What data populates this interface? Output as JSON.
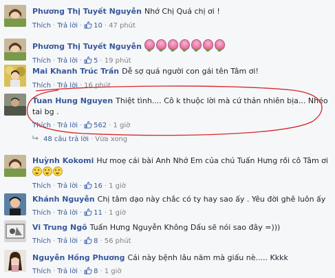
{
  "labels": {
    "like": "Thích",
    "reply": "Trả lời",
    "sep": "·"
  },
  "comments": [
    {
      "author": "Phương Thị Tuyết Nguyễn",
      "text": "Nhớ Chị Quá chị ơi !",
      "likes": "10",
      "time": "47 phút"
    },
    {
      "author": "Phương Thị Tuyết Nguyễn",
      "text": "",
      "likes": "5",
      "time": "19 phút",
      "emoji": [
        "pink-bud-emoji",
        "pink-bud-emoji",
        "pink-bud-emoji",
        "pink-bud-emoji",
        "pink-bud-emoji",
        "pink-bud-emoji",
        "pink-bud-emoji"
      ]
    },
    {
      "author": "Mai Khanh Trúc Trần",
      "text": "Dễ sợ quá người con gái tên Tâm ơi!",
      "likes": "",
      "time": "16 phút"
    },
    {
      "author": "Tuan Hung Nguyen",
      "text": "Thiệt tình.... Cô k thuộc lời mà cứ thản nhiên bịa... Nhéo",
      "text2": "tai bg .",
      "likes": "562",
      "time": "1 giờ"
    },
    {
      "author": "Huỳnh Kokomi",
      "text": "Hư moẹ cái bài Anh Nhớ Em của chú Tuấn Hưng rồi cô Tâm ơi",
      "likes": "16",
      "time": "1 giờ",
      "emoji": [
        "laughing-emoji",
        "laughing-emoji",
        "laughing-emoji"
      ]
    },
    {
      "author": "Khánh Nguyễn",
      "text": "Chị tâm dạo này chắc có ty hay sao ấy . Yêu đời ghê luôn ấy",
      "likes": "11",
      "time": "1 giờ"
    },
    {
      "author": "Vi Trung Ngô",
      "text": "Tuấn Hưng Nguyễn Không Dấu sẽ nói sao đây =)))",
      "likes": "8",
      "time": "56 phút"
    },
    {
      "author": "Nguyễn Hồng Phương",
      "text": "Cái này bệnh lâu năm mà giấu nè..... Kkkk",
      "likes": "8",
      "time": "1 giờ"
    }
  ],
  "replies_summary": {
    "text": "48 câu trả lời",
    "time": "Vừa xong"
  },
  "colors": {
    "link": "#365899",
    "meta": "#90949c",
    "annotation": "#d6262b",
    "background": "#f6f7f9"
  }
}
